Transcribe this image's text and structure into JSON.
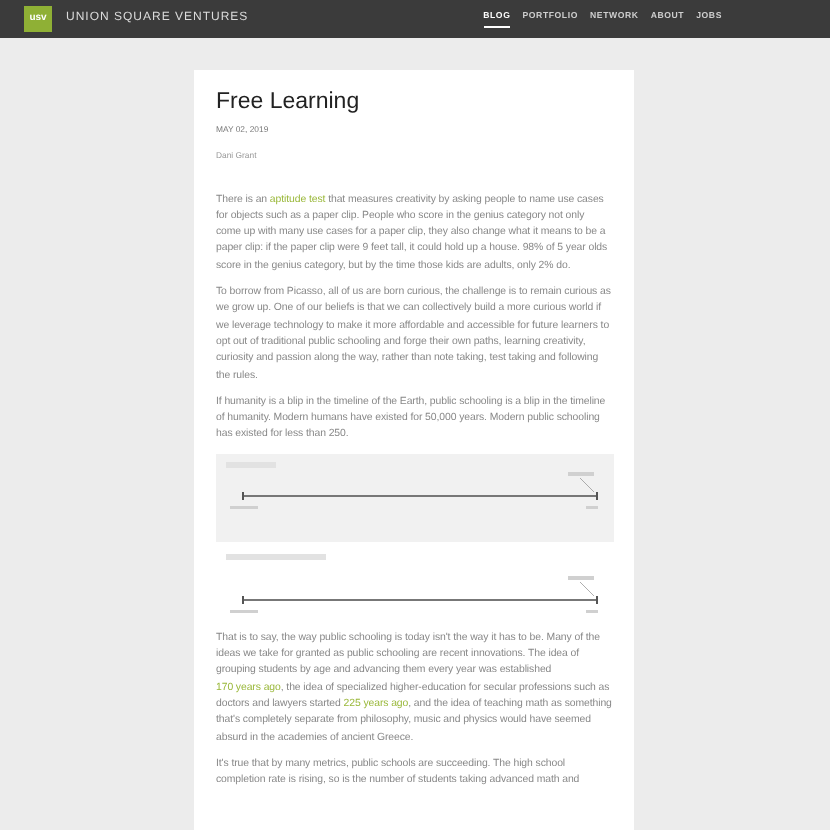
{
  "header": {
    "logo": "usv",
    "brand": "UNION SQUARE VENTURES",
    "nav": [
      {
        "label": "BLOG",
        "selected": true
      },
      {
        "label": "PORTFOLIO",
        "selected": false
      },
      {
        "label": "NETWORK",
        "selected": false
      },
      {
        "label": "ABOUT",
        "selected": false
      },
      {
        "label": "JOBS",
        "selected": false
      }
    ]
  },
  "post": {
    "title": "Free Learning",
    "date": "MAY 02, 2019",
    "author": "Dani Grant",
    "blocks": [
      {
        "kind": "paragraph",
        "segments": [
          {
            "kind": "text",
            "text": "There is an "
          },
          {
            "kind": "link",
            "text": "aptitude test"
          },
          {
            "kind": "text",
            "text": " that measures creativity by asking people to name use cases for objects such as a paper clip. People who score in the genius category not only come up with many use cases for a paper clip, they also change what it means to be a paper clip: if the paper clip were 9 feet tall, it could hold up a house. 98% of 5 year olds score in the genius category, but by the time those kids are adults, only 2% do."
          }
        ]
      },
      {
        "kind": "paragraph",
        "segments": [
          {
            "kind": "text",
            "text": "To borrow from Picasso, all of us are born curious, the challenge is to remain curious as we grow up. One of our beliefs is that we can collectively build a more curious world if we leverage technology to make it more affordable and accessible for future learners to opt out of traditional public schooling and forge their own paths, learning creativity, curiosity and passion along the way, rather than note taking, test taking and following the rules."
          }
        ]
      },
      {
        "kind": "paragraph",
        "segments": [
          {
            "kind": "text",
            "text": "If humanity is a blip in the timeline of the Earth, public schooling is a blip in the timeline of humanity. Modern humans have existed for 50,000 years. Modern public schooling has existed for less than 250."
          }
        ]
      },
      {
        "kind": "figure"
      },
      {
        "kind": "figure"
      },
      {
        "kind": "paragraph",
        "segments": [
          {
            "kind": "text",
            "text": "That is to say, the way public schooling is today isn't the way it has to be. Many of the ideas we take for granted as public schooling are recent innovations. The idea of grouping students by age and advancing them every year was established "
          },
          {
            "kind": "link",
            "text": "170 years ago"
          },
          {
            "kind": "text",
            "text": ", the idea of specialized higher-education for secular professions such as doctors and lawyers started "
          },
          {
            "kind": "link",
            "text": "225 years ago"
          },
          {
            "kind": "text",
            "text": ", and the idea of teaching math as something that's completely separate from philosophy, music and physics would have seemed absurd in the academies of ancient Greece."
          }
        ]
      },
      {
        "kind": "paragraph",
        "segments": [
          {
            "kind": "text",
            "text": "It's true that by many metrics, public schools are succeeding. The high school completion rate is rising, so is the number of students taking advanced math and"
          }
        ]
      }
    ]
  }
}
